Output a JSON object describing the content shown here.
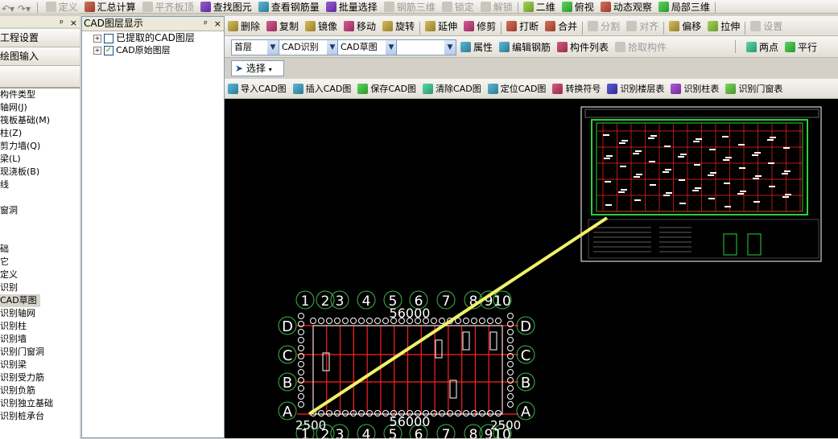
{
  "top_toolbar": {
    "items": [
      {
        "label": "定义",
        "icon": "define-icon",
        "enabled": false
      },
      {
        "label": "汇总计算",
        "icon": "sigma-icon",
        "enabled": true
      },
      {
        "label": "平齐板顶",
        "icon": "flush-slab-icon",
        "enabled": false
      },
      {
        "label": "查找图元",
        "icon": "find-element-icon",
        "enabled": true
      },
      {
        "label": "查看钢筋量",
        "icon": "view-rebar-icon",
        "enabled": true
      },
      {
        "label": "批量选择",
        "icon": "batch-select-icon",
        "enabled": true
      },
      {
        "label": "钢筋三维",
        "icon": "rebar-3d-icon",
        "enabled": false
      },
      {
        "label": "锁定",
        "icon": "lock-icon",
        "enabled": false
      },
      {
        "label": "解锁",
        "icon": "unlock-icon",
        "enabled": false
      },
      {
        "label": "二维",
        "icon": "2d-view-icon",
        "enabled": true
      },
      {
        "label": "俯视",
        "icon": "top-view-icon",
        "enabled": true
      },
      {
        "label": "动态观察",
        "icon": "orbit-icon",
        "enabled": true
      },
      {
        "label": "局部三维",
        "icon": "local-3d-icon",
        "enabled": true
      }
    ]
  },
  "nav_panel": {
    "buttons": [
      "工程设置",
      "绘图输入"
    ],
    "tree_items": [
      "构件类型",
      "轴网(J)",
      "筏板基础(M)",
      "柱(Z)",
      "剪力墙(Q)",
      "梁(L)",
      "现浇板(B)",
      "线",
      "",
      "窗洞",
      "",
      "",
      "础",
      "它",
      "定义",
      "识别",
      "CAD草图",
      "识别轴网",
      "识别柱",
      "识别墙",
      "识别门窗洞",
      "识别梁",
      "识别受力筋",
      "识别负筋",
      "识别独立基础",
      "识别桩承台"
    ],
    "selected_index": 16
  },
  "layer_panel": {
    "title": "CAD图层显示",
    "pin_glyph": "ᵖ",
    "close_glyph": "×",
    "layers": [
      {
        "label": "已提取的CAD图层",
        "checked": false
      },
      {
        "label": "CAD原始图层",
        "checked": true
      }
    ]
  },
  "edit_toolbar": {
    "items": [
      {
        "label": "删除",
        "icon": "delete-icon",
        "enabled": true
      },
      {
        "label": "复制",
        "icon": "copy-icon",
        "enabled": true
      },
      {
        "label": "镜像",
        "icon": "mirror-icon",
        "enabled": true
      },
      {
        "label": "移动",
        "icon": "move-icon",
        "enabled": true
      },
      {
        "label": "旋转",
        "icon": "rotate-icon",
        "enabled": true
      },
      {
        "label": "延伸",
        "icon": "extend-icon",
        "enabled": true
      },
      {
        "label": "修剪",
        "icon": "trim-icon",
        "enabled": true
      },
      {
        "label": "打断",
        "icon": "break-icon",
        "enabled": true
      },
      {
        "label": "合并",
        "icon": "merge-icon",
        "enabled": true
      },
      {
        "label": "分割",
        "icon": "split-icon",
        "enabled": false
      },
      {
        "label": "对齐",
        "icon": "align-icon",
        "enabled": false
      },
      {
        "label": "偏移",
        "icon": "offset-icon",
        "enabled": true
      },
      {
        "label": "拉伸",
        "icon": "stretch-icon",
        "enabled": true
      },
      {
        "label": "设置",
        "icon": "settings-icon",
        "enabled": false
      }
    ]
  },
  "selector_toolbar": {
    "floor": "首层",
    "recognize": "CAD识别",
    "sketch": "CAD草图",
    "blank": "",
    "buttons": [
      {
        "label": "属性",
        "icon": "properties-icon",
        "enabled": true
      },
      {
        "label": "编辑钢筋",
        "icon": "edit-rebar-icon",
        "enabled": true
      },
      {
        "label": "构件列表",
        "icon": "component-list-icon",
        "enabled": true
      },
      {
        "label": "拾取构件",
        "icon": "pick-component-icon",
        "enabled": false
      }
    ],
    "right_buttons": [
      {
        "label": "两点",
        "icon": "two-point-icon"
      },
      {
        "label": "平行",
        "icon": "parallel-icon"
      }
    ]
  },
  "select_toolbar": {
    "label": "选择"
  },
  "cad_toolbar": {
    "items": [
      {
        "label": "导入CAD图",
        "icon": "import-cad-icon"
      },
      {
        "label": "插入CAD图",
        "icon": "insert-cad-icon"
      },
      {
        "label": "保存CAD图",
        "icon": "save-cad-icon"
      },
      {
        "label": "清除CAD图",
        "icon": "clear-cad-icon"
      },
      {
        "label": "定位CAD图",
        "icon": "locate-cad-icon"
      },
      {
        "label": "转换符号",
        "icon": "convert-symbol-icon"
      },
      {
        "label": "识别楼层表",
        "icon": "recognize-floor-table-icon"
      },
      {
        "label": "识别柱表",
        "icon": "recognize-column-table-icon"
      },
      {
        "label": "识别门窗表",
        "icon": "recognize-door-window-table-icon"
      }
    ]
  },
  "drawing": {
    "top_axis_labels": [
      "1",
      "2",
      "3",
      "4",
      "5",
      "6",
      "7",
      "8",
      "9",
      "10"
    ],
    "bottom_axis_labels": [
      "1",
      "2",
      "3",
      "4",
      "5",
      "6",
      "7",
      "8",
      "9",
      "10"
    ],
    "left_axis_labels": [
      "D",
      "C",
      "B",
      "A"
    ],
    "right_axis_labels": [
      "D",
      "C",
      "B",
      "A"
    ],
    "top_dimension": "56000",
    "bottom_dimension": "56000",
    "left_dimension": "2500",
    "right_dimension": "2500",
    "colors": {
      "background": "#000000",
      "grid": "#ff2020",
      "axis_circle": "#3cb84a",
      "text": "#ffffff",
      "leader": "#f1f16a",
      "plan_border": "#ffffff",
      "plan_green": "#27d23a"
    }
  }
}
